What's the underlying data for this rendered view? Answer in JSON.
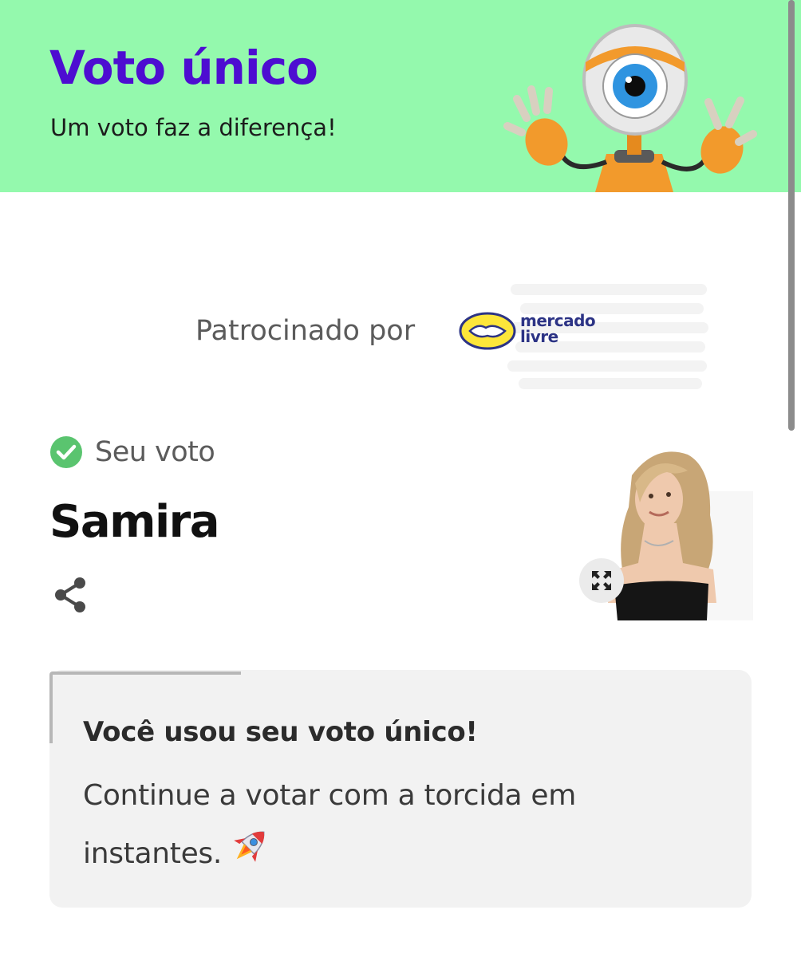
{
  "header": {
    "title": "Voto único",
    "subtitle": "Um voto faz a diferença!",
    "background_color": "#94f9ad",
    "title_color": "#4d0dd1",
    "mascot_icon": "big-brother-eye-mascot"
  },
  "sponsor": {
    "label": "Patrocinado por",
    "brand_logo_text": "mercado\nlivre",
    "logo_icon": "handshake-logo"
  },
  "vote": {
    "status_label": "Seu voto",
    "status_icon": "check-circle-icon",
    "status_color": "#5ac46f",
    "candidate_name": "Samira",
    "share_icon": "share-icon",
    "expand_icon": "expand-icon"
  },
  "notice": {
    "title": "Você usou seu voto único!",
    "message": "Continue a votar com a torcida em instantes.",
    "emoji_icon": "rocket-icon"
  }
}
